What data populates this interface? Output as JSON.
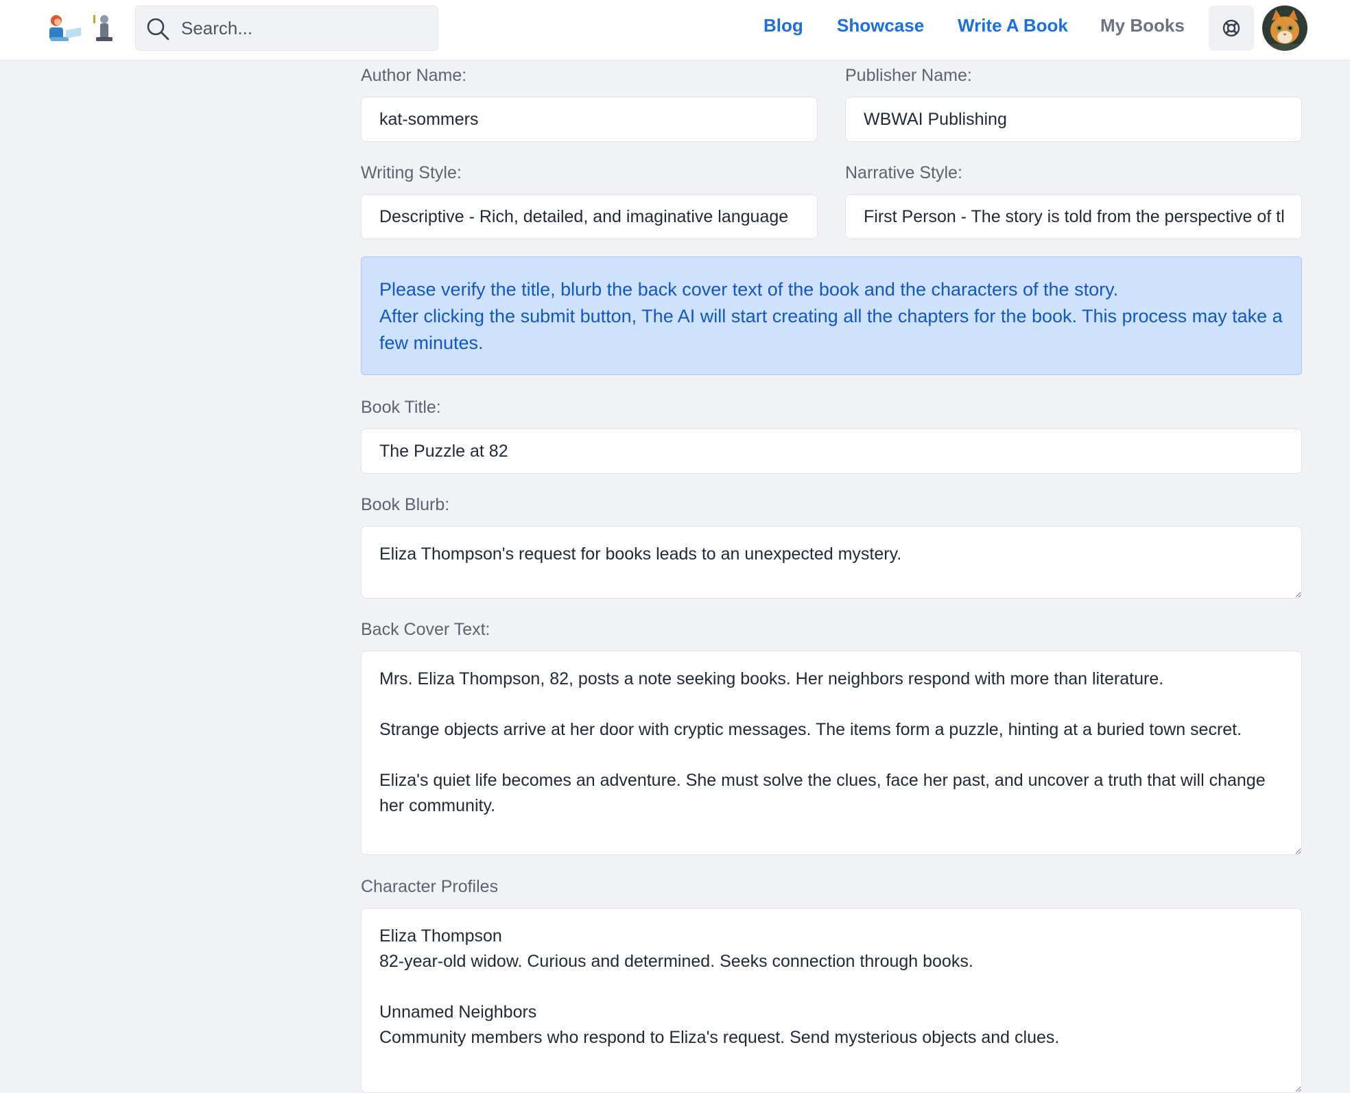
{
  "navbar": {
    "search": {
      "placeholder": "Search...",
      "value": ""
    },
    "links": {
      "blog": "Blog",
      "showcase": "Showcase",
      "write_a_book": "Write A Book",
      "my_books": "My Books"
    },
    "icons": {
      "search": "search-icon",
      "support": "lifebuoy-icon",
      "avatar": "cat-avatar"
    },
    "colors": {
      "link_active": "#1a6fdc",
      "link_muted": "#6b7280"
    }
  },
  "form": {
    "author_name": {
      "label": "Author Name:",
      "value": "kat-sommers"
    },
    "publisher_name": {
      "label": "Publisher Name:",
      "value": "WBWAI Publishing"
    },
    "writing_style": {
      "label": "Writing Style:",
      "value": "Descriptive - Rich, detailed, and imaginative language"
    },
    "narrative_style": {
      "label": "Narrative Style:",
      "value": "First Person - The story is told from the perspective of the narrator"
    },
    "notice": {
      "line1": "Please verify the title, blurb the back cover text of the book and the characters of the story.",
      "line2": "After clicking the submit button, The AI will start creating all the chapters for the book. This process may take a few minutes.",
      "color_bg": "#cfe2fd",
      "color_text": "#1257c7"
    },
    "book_title": {
      "label": "Book Title:",
      "value": "The Puzzle at 82"
    },
    "book_blurb": {
      "label": "Book Blurb:",
      "value": "Eliza Thompson's request for books leads to an unexpected mystery."
    },
    "back_cover_text": {
      "label": "Back Cover Text:",
      "value": "Mrs. Eliza Thompson, 82, posts a note seeking books. Her neighbors respond with more than literature.\n\nStrange objects arrive at her door with cryptic messages. The items form a puzzle, hinting at a buried town secret.\n\nEliza's quiet life becomes an adventure. She must solve the clues, face her past, and uncover a truth that will change her community."
    },
    "character_profiles": {
      "label": "Character Profiles",
      "value": "Eliza Thompson\n82-year-old widow. Curious and determined. Seeks connection through books.\n\nUnnamed Neighbors\nCommunity members who respond to Eliza's request. Send mysterious objects and clues."
    }
  }
}
